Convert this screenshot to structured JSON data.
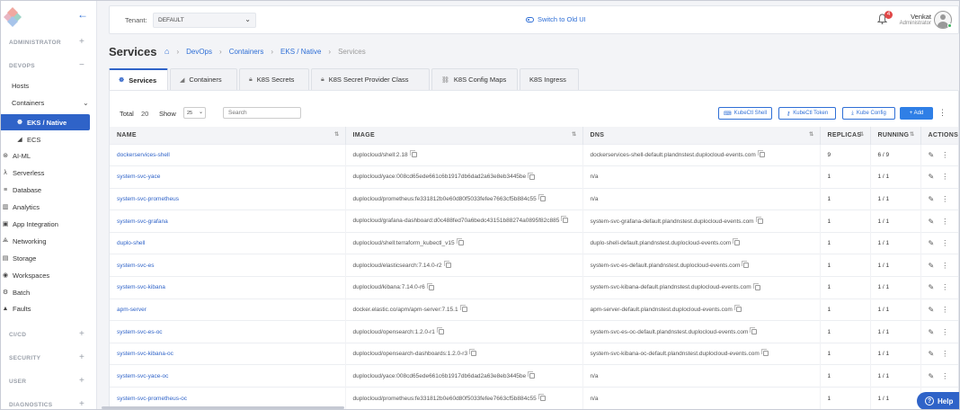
{
  "sidebar": {
    "sections": {
      "administrator": "ADMINISTRATOR",
      "devops": "DEVOPS",
      "cicd": "CI/CD",
      "security": "SECURITY",
      "user": "USER",
      "diagnostics": "DIAGNOSTICS"
    },
    "items": {
      "hosts": "Hosts",
      "containers": "Containers",
      "eks_native": "EKS / Native",
      "ecs": "ECS",
      "ai_ml": "AI-ML",
      "serverless": "Serverless",
      "database": "Database",
      "analytics": "Analytics",
      "app_integration": "App Integration",
      "networking": "Networking",
      "storage": "Storage",
      "workspaces": "Workspaces",
      "batch": "Batch",
      "faults": "Faults"
    }
  },
  "topbar": {
    "tenant_label": "Tenant:",
    "tenant_value": "DEFAULT",
    "switch_ui": "Switch to Old UI",
    "notification_count": "4",
    "user_name": "Venkat",
    "user_role": "Administrator"
  },
  "page": {
    "title": "Services",
    "breadcrumb": {
      "devops": "DevOps",
      "containers": "Containers",
      "eks": "EKS / Native",
      "current": "Services"
    }
  },
  "tabs": {
    "services": "Services",
    "containers": "Containers",
    "k8s_secrets": "K8S Secrets",
    "k8s_secret_provider_class": "K8S Secret Provider Class",
    "k8s_config_maps": "K8S Config Maps",
    "k8s_ingress": "K8S Ingress"
  },
  "toolbar": {
    "total_label": "Total",
    "total_value": "20",
    "show_label": "Show",
    "show_value": "25",
    "search_placeholder": "Search",
    "kubectl_shell": "KubeCtl Shell",
    "kubectl_token": "KubeCtl Token",
    "kube_config": "Kube Config",
    "add": "+ Add"
  },
  "table": {
    "headers": {
      "name": "NAME",
      "image": "IMAGE",
      "dns": "DNS",
      "replicas": "REPLICAS",
      "running": "RUNNING",
      "actions": "ACTIONS"
    },
    "rows": [
      {
        "name": "dockerservices-shell",
        "image": "duplocloud/shell:2.18",
        "dns": "dockerservices-shell-default.plandnstest.duplocloud-events.com",
        "replicas": "9",
        "running": "6 / 9"
      },
      {
        "name": "system-svc-yace",
        "image": "duplocloud/yace:008cd65ede661c6b1917db6dad2a63e8eb3445be",
        "dns": "n/a",
        "replicas": "1",
        "running": "1 / 1"
      },
      {
        "name": "system-svc-prometheus",
        "image": "duplocloud/prometheus:fe331812b0e60d80f5033fefee7663cf5b884c55",
        "dns": "n/a",
        "replicas": "1",
        "running": "1 / 1"
      },
      {
        "name": "system-svc-grafana",
        "image": "duplocloud/grafana-dashboard:d0c488fed70a6bedc43151b88274a0895f82c885",
        "dns": "system-svc-grafana-default.plandnstest.duplocloud-events.com",
        "replicas": "1",
        "running": "1 / 1"
      },
      {
        "name": "duplo-shell",
        "image": "duplocloud/shell:terraform_kubectl_v15",
        "dns": "duplo-shell-default.plandnstest.duplocloud-events.com",
        "replicas": "1",
        "running": "1 / 1"
      },
      {
        "name": "system-svc-es",
        "image": "duplocloud/elasticsearch:7.14.0-r2",
        "dns": "system-svc-es-default.plandnstest.duplocloud-events.com",
        "replicas": "1",
        "running": "1 / 1"
      },
      {
        "name": "system-svc-kibana",
        "image": "duplocloud/kibana:7.14.0-r6",
        "dns": "system-svc-kibana-default.plandnstest.duplocloud-events.com",
        "replicas": "1",
        "running": "1 / 1"
      },
      {
        "name": "apm-server",
        "image": "docker.elastic.co/apm/apm-server:7.15.1",
        "dns": "apm-server-default.plandnstest.duplocloud-events.com",
        "replicas": "1",
        "running": "1 / 1"
      },
      {
        "name": "system-svc-es-oc",
        "image": "duplocloud/opensearch:1.2.0-r1",
        "dns": "system-svc-es-oc-default.plandnstest.duplocloud-events.com",
        "replicas": "1",
        "running": "1 / 1"
      },
      {
        "name": "system-svc-kibana-oc",
        "image": "duplocloud/opensearch-dashboards:1.2.0-r3",
        "dns": "system-svc-kibana-oc-default.plandnstest.duplocloud-events.com",
        "replicas": "1",
        "running": "1 / 1"
      },
      {
        "name": "system-svc-yace-oc",
        "image": "duplocloud/yace:008cd65ede661c6b1917db6dad2a63e8eb3445be",
        "dns": "n/a",
        "replicas": "1",
        "running": "1 / 1"
      },
      {
        "name": "system-svc-prometheus-oc",
        "image": "duplocloud/prometheus:fe331812b0e60d80f5033fefee7663cf5b884c55",
        "dns": "n/a",
        "replicas": "1",
        "running": "1 / 1"
      }
    ]
  },
  "help": {
    "label": "Help"
  },
  "colors": {
    "accent": "#2f63c8",
    "link": "#2f6fd6",
    "badge": "#e04848",
    "online": "#3bb45c"
  }
}
